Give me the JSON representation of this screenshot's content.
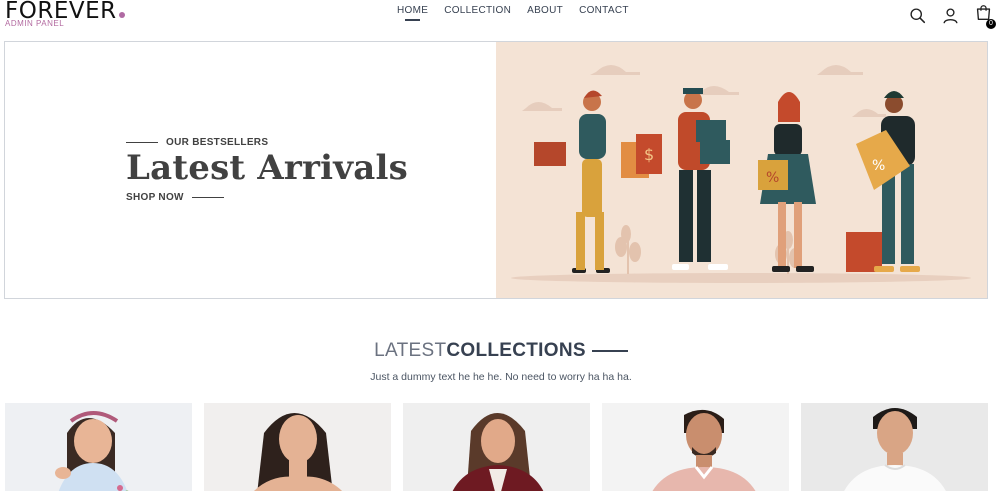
{
  "brand": {
    "logo_text": "FOREVER",
    "subtitle": "ADMIN PANEL",
    "dot_color": "#b06aa3"
  },
  "nav": {
    "items": [
      {
        "label": "HOME",
        "active": true
      },
      {
        "label": "COLLECTION",
        "active": false
      },
      {
        "label": "ABOUT",
        "active": false
      },
      {
        "label": "CONTACT",
        "active": false
      }
    ]
  },
  "header_icons": [
    "search-icon",
    "profile-icon",
    "cart-icon"
  ],
  "cart": {
    "count": "0"
  },
  "hero": {
    "kicker": "OUR BESTSELLERS",
    "title": "Latest Arrivals",
    "cta": "SHOP NOW",
    "image_bg": "#f4e3d5"
  },
  "collection": {
    "title_light": "LATEST",
    "title_bold": "COLLECTIONS",
    "subtitle": "Just a dummy text he he he. No need to worry ha ha ha."
  },
  "products": [
    {
      "image": "girl-floral-top",
      "bg": "#eef0f3"
    },
    {
      "image": "woman-off-shoulder",
      "bg": "#f1efee"
    },
    {
      "image": "woman-maroon-jacket",
      "bg": "#efefef"
    },
    {
      "image": "man-pink-shirt",
      "bg": "#f3f3f3"
    },
    {
      "image": "man-white-tshirt",
      "bg": "#e9e9e9"
    }
  ]
}
